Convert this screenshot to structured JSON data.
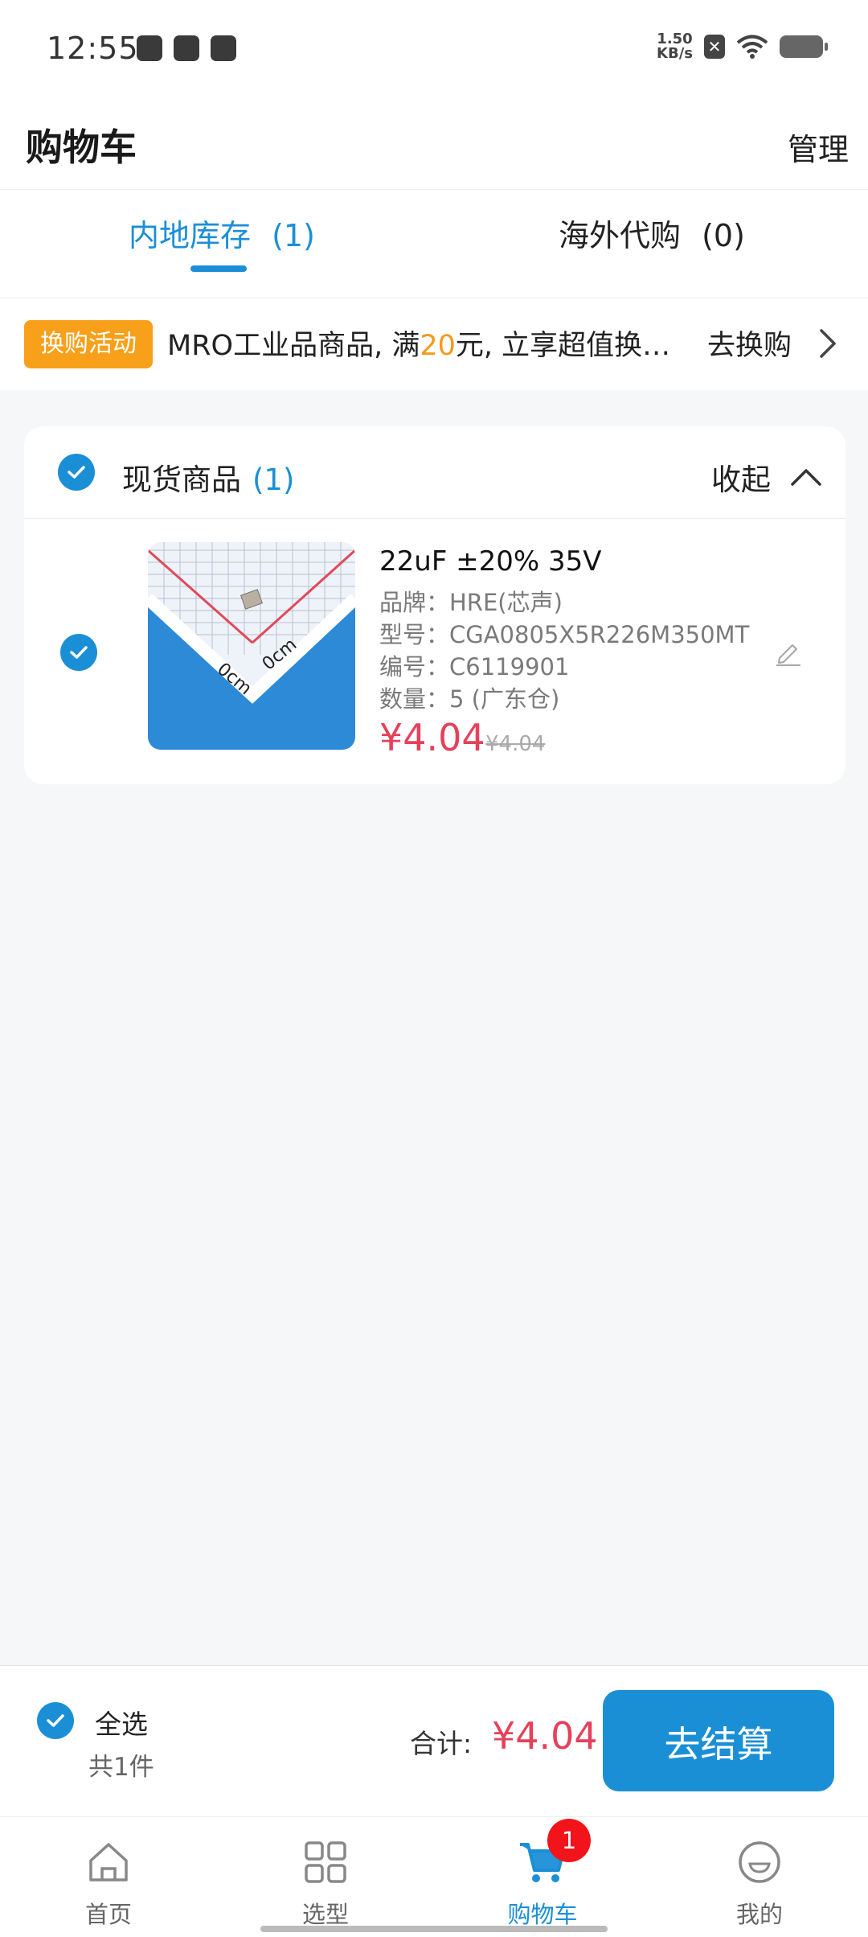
{
  "status_bar": {
    "time": "12:55",
    "net_speed_top": "1.50",
    "net_speed_bottom": "KB/s"
  },
  "header": {
    "title": "购物车",
    "manage_label": "管理"
  },
  "tabs": [
    {
      "label": "内地库存",
      "count": "(1)",
      "active": true
    },
    {
      "label": "海外代购",
      "count": "(0)",
      "active": false
    }
  ],
  "promo": {
    "badge": "换购活动",
    "text_before": "MRO工业品商品, 满",
    "highlight": "20",
    "text_after": "元, 立享超值换…",
    "link_label": "去换购"
  },
  "cart_group": {
    "title": "现货商品",
    "count": "(1)",
    "collapse_label": "收起",
    "items": [
      {
        "title": "22uF ±20% 35V",
        "brand": "品牌：HRE(芯声)",
        "model": "型号：CGA0805X5R226M350MT",
        "code": "编号：C6119901",
        "quantity": "数量：5 (广东仓)",
        "price": "¥4.04",
        "original_price": "¥4.04",
        "checked": true
      }
    ]
  },
  "summary": {
    "select_all_label": "全选",
    "count_text": "共1件",
    "total_label": "合计:",
    "total_value": "¥4.04",
    "checkout_label": "去结算"
  },
  "bottom_nav": {
    "items": [
      {
        "label": "首页",
        "icon": "home-icon"
      },
      {
        "label": "选型",
        "icon": "grid-icon"
      },
      {
        "label": "购物车",
        "icon": "cart-icon",
        "active": true,
        "badge": "1"
      },
      {
        "label": "我的",
        "icon": "profile-icon"
      }
    ]
  },
  "colors": {
    "accent": "#1b8fd6",
    "price": "#e5415a",
    "promo_badge": "#f8a01a",
    "badge_red": "#f2141a"
  }
}
